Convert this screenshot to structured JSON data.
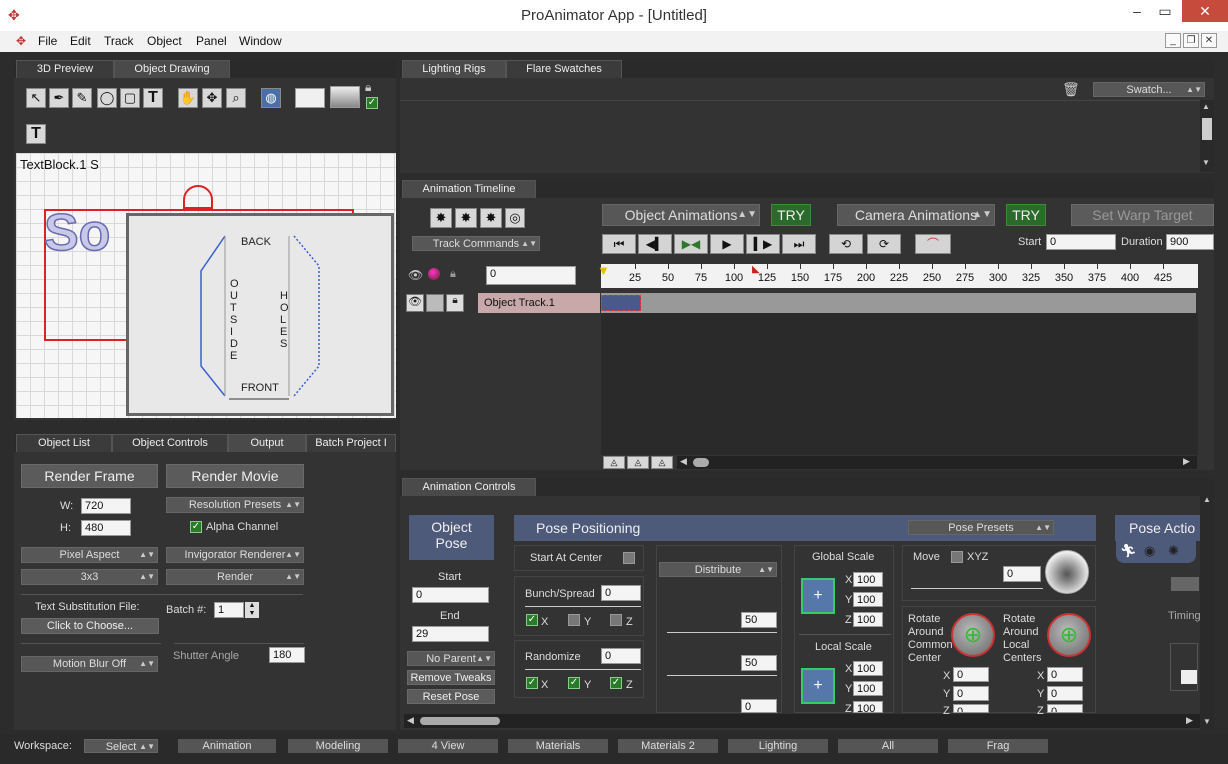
{
  "window": {
    "title": "ProAnimator App - [Untitled]",
    "minimize": "–",
    "maximize": "▭",
    "close": "✕"
  },
  "menu": [
    "File",
    "Edit",
    "Track",
    "Object",
    "Panel",
    "Window"
  ],
  "left_top": {
    "tabs": [
      "3D Preview",
      "Object Drawing"
    ],
    "text_tool": "T",
    "canvas_label": "TextBlock.1 S",
    "canvas_words": [
      "So",
      "BACK",
      "OUTSIDE",
      "HOLES",
      "FRONT"
    ]
  },
  "left_bottom": {
    "tabs": [
      "Object List",
      "Object Controls",
      "Output",
      "Batch Project I"
    ],
    "render_frame": "Render Frame",
    "render_movie": "Render Movie",
    "w_label": "W:",
    "w_value": "720",
    "h_label": "H:",
    "h_value": "480",
    "resolution_presets": "Resolution Presets",
    "alpha_channel": "Alpha Channel",
    "pixel_aspect": "Pixel Aspect",
    "renderer": "Invigorator Renderer",
    "aa": "3x3",
    "render": "Render",
    "text_sub_label": "Text Substitution File:",
    "click_choose": "Click to Choose...",
    "batch_label": "Batch #:",
    "batch_value": "1",
    "motion_blur": "Motion Blur Off",
    "shutter_label": "Shutter Angle",
    "shutter_value": "180"
  },
  "lighting": {
    "tabs": [
      "Lighting Rigs",
      "Flare Swatches"
    ],
    "swatch": "Swatch..."
  },
  "timeline": {
    "tab": "Animation Timeline",
    "track_commands": "Track Commands",
    "object_animations": "Object Animations",
    "try1": "TRY",
    "camera_animations": "Camera Animations",
    "try2": "TRY",
    "set_warp": "Set Warp Target",
    "start_label": "Start",
    "start_value": "0",
    "duration_label": "Duration",
    "duration_value": "900",
    "frame_value": "0",
    "ruler": [
      "25",
      "50",
      "75",
      "100",
      "125",
      "150",
      "175",
      "200",
      "225",
      "250",
      "275",
      "300",
      "325",
      "350",
      "375",
      "400",
      "425"
    ],
    "track_name": "Object Track.1"
  },
  "anim_controls": {
    "tab": "Animation Controls",
    "object_pose": "Object Pose",
    "start_label": "Start",
    "start_value": "0",
    "end_label": "End",
    "end_value": "29",
    "no_parent": "No Parent",
    "remove_tweaks": "Remove Tweaks",
    "reset_pose": "Reset Pose",
    "pose_positioning": "Pose Positioning",
    "pose_presets": "Pose Presets",
    "start_at_center": "Start At Center",
    "bunch_spread": "Bunch/Spread",
    "bunch_value": "0",
    "randomize": "Randomize",
    "randomize_value": "0",
    "x": "X",
    "y": "Y",
    "z": "Z",
    "distribute": "Distribute",
    "dist_v1": "50",
    "dist_v2": "50",
    "dist_v3": "0",
    "global_scale": "Global Scale",
    "gs_x": "100",
    "gs_y": "100",
    "gs_z": "100",
    "local_scale": "Local Scale",
    "ls_x": "100",
    "ls_y": "100",
    "ls_z": "100",
    "move": "Move",
    "xyz": "XYZ",
    "move_value": "0",
    "rotate_common": "Rotate Around Common Center",
    "rotate_local": "Rotate Around Local Centers",
    "rc_x": "0",
    "rc_y": "0",
    "rc_z": "0",
    "rl_x": "0",
    "rl_y": "0",
    "rl_z": "0",
    "pose_action": "Pose Actio",
    "timing": "Timing"
  },
  "workspace": {
    "label": "Workspace:",
    "select": "Select",
    "buttons": [
      "Animation",
      "Modeling",
      "4 View",
      "Materials",
      "Materials 2",
      "Lighting",
      "All",
      "Frag"
    ]
  },
  "colors": {
    "accent_header": "#4d5a7a",
    "try_green": "#2a6a2a",
    "close_red": "#c74b3c"
  }
}
